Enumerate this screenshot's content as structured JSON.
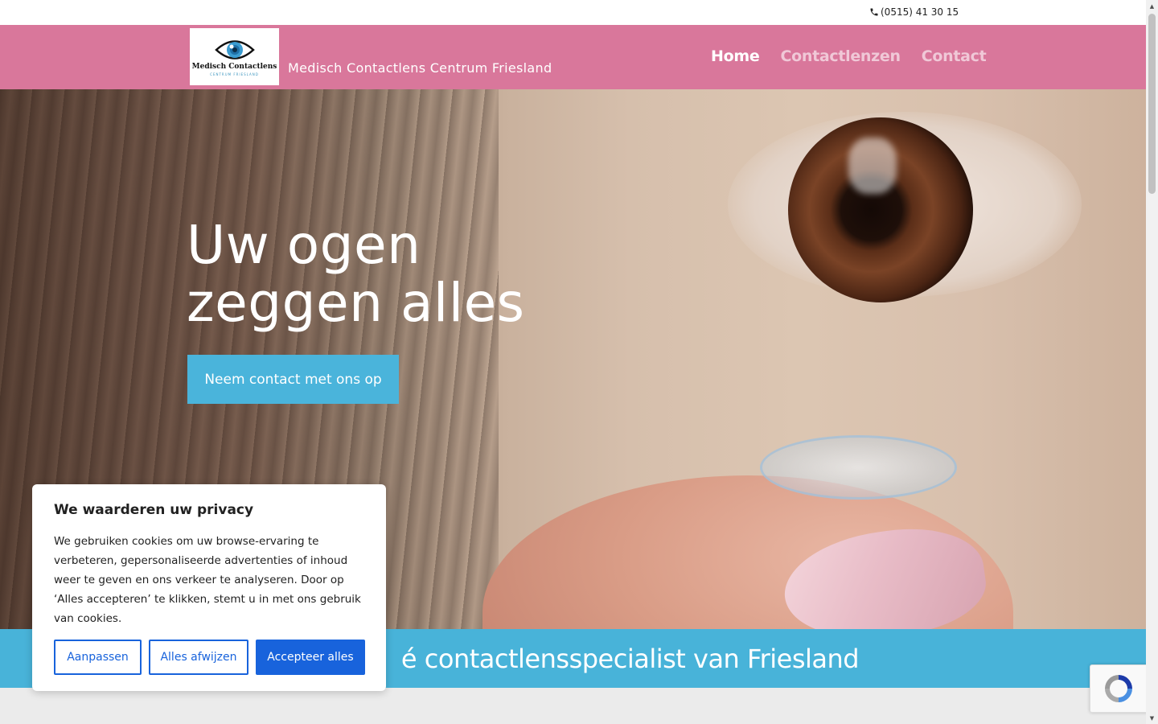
{
  "topbar": {
    "phone": "(0515) 41 30 15",
    "phone_icon": "phone-icon"
  },
  "header": {
    "logo_text": "Medisch Contactlens",
    "logo_sub": "CENTRUM FRIESLAND",
    "site_name": "Medisch Contactlens Centrum Friesland",
    "nav": [
      {
        "label": "Home",
        "active": true
      },
      {
        "label": "Contactlenzen",
        "active": false
      },
      {
        "label": "Contact",
        "active": false
      }
    ],
    "background": "#d9779b"
  },
  "hero": {
    "title_line1": "Uw ogen",
    "title_line2": "zeggen alles",
    "button_label": "Neem contact met ons op",
    "button_color": "#4ab4db"
  },
  "banner": {
    "text": "é contactlensspecialist van Friesland",
    "background": "#48b3d9"
  },
  "cookie": {
    "title": "We waarderen uw privacy",
    "body": "We gebruiken cookies om uw browse-ervaring te verbeteren, gepersonaliseerde advertenties of inhoud weer te geven en ons verkeer te analyseren. Door op ‘Alles accepteren’ te klikken, stemt u in met ons gebruik van cookies.",
    "buttons": {
      "customize": "Aanpassen",
      "reject": "Alles afwijzen",
      "accept": "Accepteer alles"
    },
    "accent": "#1863dc"
  },
  "recaptcha": {
    "icon": "recaptcha-icon"
  }
}
